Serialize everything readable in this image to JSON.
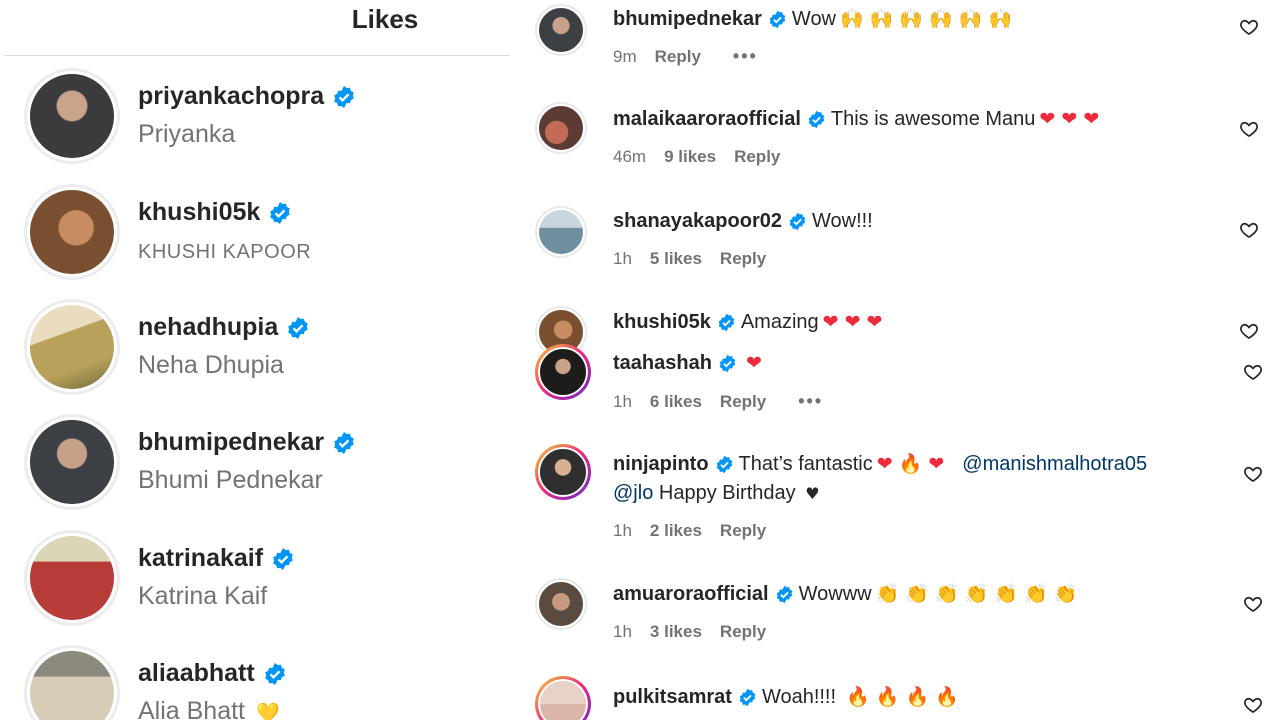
{
  "likes": {
    "title": "Likes",
    "users": [
      {
        "username": "priyankachopra",
        "display_name": "Priyanka",
        "avatar_color": "#3b3a3c"
      },
      {
        "username": "khushi05k",
        "display_name": "KHUSHI KAPOOR",
        "avatar_color": "#9a6a45"
      },
      {
        "username": "nehadhupia",
        "display_name": "Neha Dhupia",
        "avatar_color": "#b8a15a"
      },
      {
        "username": "bhumipednekar",
        "display_name": "Bhumi Pednekar",
        "avatar_color": "#3c3f44"
      },
      {
        "username": "katrinakaif",
        "display_name": "Katrina Kaif",
        "avatar_color": "#b73c37"
      },
      {
        "username": "aliaabhatt",
        "display_name": "Alia Bhatt",
        "avatar_color": "#b4a590"
      }
    ],
    "last_name_emoji": "💛"
  },
  "comments": [
    {
      "username": "bhumipednekar",
      "text": "Wow",
      "emojis": "🙌 🙌 🙌 🙌 🙌 🙌",
      "time": "9m",
      "likes": "",
      "reply": "Reply",
      "more": "•••",
      "avatar_color": "#3c3f44"
    },
    {
      "username": "malaikaaroraofficial",
      "text": "This is awesome Manu",
      "emojis": "❤ ❤ ❤",
      "time": "46m",
      "likes": "9 likes",
      "reply": "Reply",
      "avatar_color": "#a6534a"
    },
    {
      "username": "shanayakapoor02",
      "text": "Wow!!!",
      "time": "1h",
      "likes": "5 likes",
      "reply": "Reply",
      "avatar_color": "#6f8fa0"
    },
    {
      "username": "khushi05k",
      "text": "Amazing",
      "emojis": "❤ ❤ ❤",
      "avatar_color": "#9a6a45"
    },
    {
      "username": "taahashah",
      "text": "",
      "emojis": "❤",
      "time": "1h",
      "likes": "6 likes",
      "reply": "Reply",
      "more": "•••",
      "avatar_color": "#2e2a2a"
    },
    {
      "username": "ninjapinto",
      "text": "That’s fantastic",
      "emojis": "❤ 🔥 ❤",
      "mention1": "@manishmalhotra05",
      "mention2": "@jlo",
      "text2": "Happy Birthday",
      "text2_emoji": "♥",
      "time": "1h",
      "likes": "2 likes",
      "reply": "Reply",
      "avatar_color": "#2f2f2f"
    },
    {
      "username": "amuaroraofficial",
      "text": "Wowww",
      "emojis": "👏 👏 👏 👏 👏 👏 👏",
      "time": "1h",
      "likes": "3 likes",
      "reply": "Reply",
      "avatar_color": "#5a4a40"
    },
    {
      "username": "pulkitsamrat",
      "text": "Woah!!!!",
      "emojis": "🔥 🔥 🔥 🔥",
      "avatar_color": "#d9b6a8"
    }
  ],
  "colors": {
    "verified": "#0095f6",
    "mention": "#00376b",
    "meta": "#737373"
  }
}
